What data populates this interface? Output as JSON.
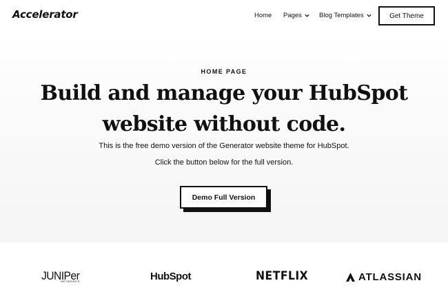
{
  "header": {
    "logo": "Accelerator",
    "nav": [
      {
        "label": "Home"
      },
      {
        "label": "Pages"
      },
      {
        "label": "Blog Templates"
      }
    ],
    "cta_label": "Get Theme"
  },
  "hero": {
    "eyebrow": "HOME PAGE",
    "headline_line1": "Build and manage your HubSpot",
    "headline_line2": "website without code.",
    "sub_line1": "This is the free demo version of the Generator website theme for HubSpot.",
    "sub_line2": "Click the button below for the full version.",
    "button_label": "Demo Full Version"
  },
  "logos": {
    "juniper": "JUNIPer",
    "juniper_sub": "NETWORKS",
    "hubspot": "HubSpot",
    "netflix": "NETFLIX",
    "atlassian": "ATLASSIAN"
  }
}
